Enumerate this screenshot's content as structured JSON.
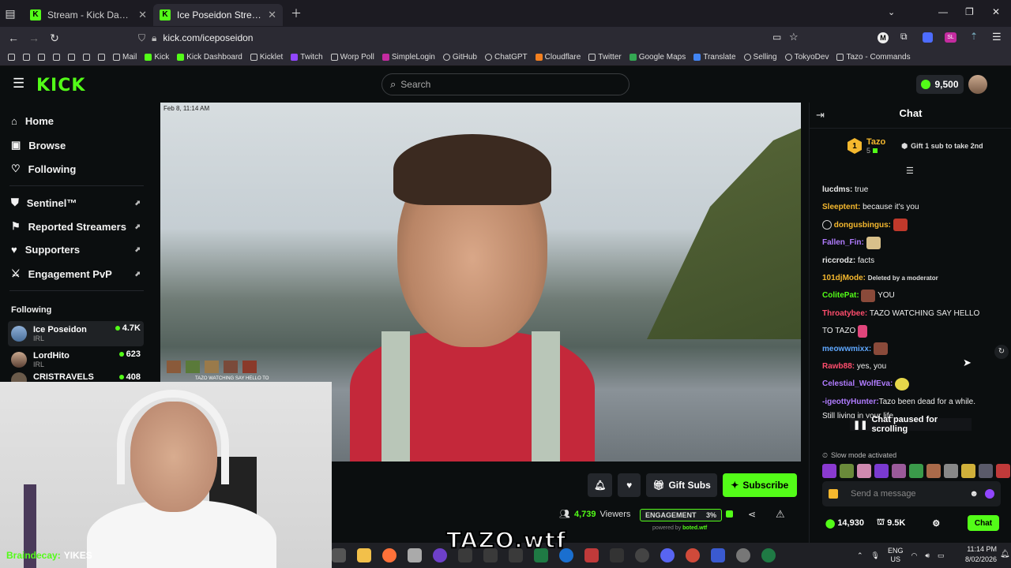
{
  "browser": {
    "tabs": [
      {
        "title": "Stream - Kick Dashboard",
        "active": false
      },
      {
        "title": "Ice Poseidon Stream - Watch",
        "active": true
      }
    ],
    "url": "kick.com/iceposeidon",
    "bookmarks": [
      "Mail",
      "Kick",
      "Kick Dashboard",
      "Kicklet",
      "Twitch",
      "Worp Poll",
      "SimpleLogin",
      "GitHub",
      "ChatGPT",
      "Cloudflare",
      "Twitter",
      "Google Maps",
      "Translate",
      "Selling",
      "TokyoDev",
      "Tazo - Commands"
    ]
  },
  "header": {
    "logo": "KICK",
    "search_placeholder": "Search",
    "balance": "9,500"
  },
  "sidebar": {
    "nav": [
      "Home",
      "Browse",
      "Following"
    ],
    "tools": [
      "Sentinel™",
      "Reported Streamers",
      "Supporters",
      "Engagement PvP"
    ],
    "following_title": "Following",
    "following": [
      {
        "name": "Ice Poseidon",
        "category": "IRL",
        "viewers": "4.7K"
      },
      {
        "name": "LordHito",
        "category": "IRL",
        "viewers": "623"
      },
      {
        "name": "CRISTRAVELS",
        "category": "",
        "viewers": "408"
      }
    ]
  },
  "video": {
    "timestamp": "Feb 8, 11:14 AM",
    "overlay_text": "TAZO WATCHING SAY HELLO TO"
  },
  "webcam": {
    "caption_user": "Braindecay:",
    "caption_text": "YIKES"
  },
  "stream": {
    "gift_label": "Gift Subs",
    "subscribe_label": "Subscribe",
    "viewers_count": "4,739",
    "viewers_label": "Viewers",
    "engagement_label": "ENGAGEMENT",
    "engagement_value": "3%",
    "powered_prefix": "powered by",
    "powered_by": "boted.wtf"
  },
  "chat": {
    "title": "Chat",
    "pinned_name": "Tazo",
    "pinned_count": "5",
    "gift_prompt": "Gift 1 sub to take 2nd",
    "messages": [
      {
        "user": "lucdms:",
        "text": "true",
        "color": "#e8e8e8"
      },
      {
        "user": "Sleeptent:",
        "text": "because it's you",
        "color": "#f5b82e"
      },
      {
        "user": "dongusbingus:",
        "text": "",
        "color": "#f5b82e"
      },
      {
        "user": "Fallen_Fin:",
        "text": "",
        "color": "#b07cff"
      },
      {
        "user": "riccrodz:",
        "text": "facts",
        "color": "#e8e8e8"
      },
      {
        "user": "101djMode:",
        "text": "Deleted by a moderator",
        "color": "#f5b82e"
      },
      {
        "user": "ColitePat:",
        "text": "YOU",
        "color": "#53fc18"
      },
      {
        "user": "Throatybee:",
        "text": "TAZO WATCHING SAY HELLO",
        "color": "#ff4d6d"
      },
      {
        "user": "",
        "text": "TO TAZO",
        "color": "#e8e8e8"
      },
      {
        "user": "meowwmixx:",
        "text": "",
        "color": "#5fa8ff"
      },
      {
        "user": "Rawb88:",
        "text": "yes, you",
        "color": "#ff4d6d"
      },
      {
        "user": "Celestial_WolfEva:",
        "text": "",
        "color": "#b07cff"
      },
      {
        "user": "-igeottyHunter:",
        "text": "Tazo been dead for a while.",
        "color": "#b07cff"
      },
      {
        "user": "",
        "text": "Still living in your life .",
        "color": "#e8e8e8"
      }
    ],
    "paused_label": "Chat paused for scrolling",
    "slow_mode": "Slow mode activated",
    "send_placeholder": "Send a message",
    "points": "14,930",
    "followers": "9.5K",
    "chat_button": "Chat"
  },
  "overlay_brand": "TAZO.wtf",
  "taskbar": {
    "lang_top": "ENG",
    "lang_bottom": "US",
    "time": "11:14 PM",
    "date": "8/02/2026"
  }
}
